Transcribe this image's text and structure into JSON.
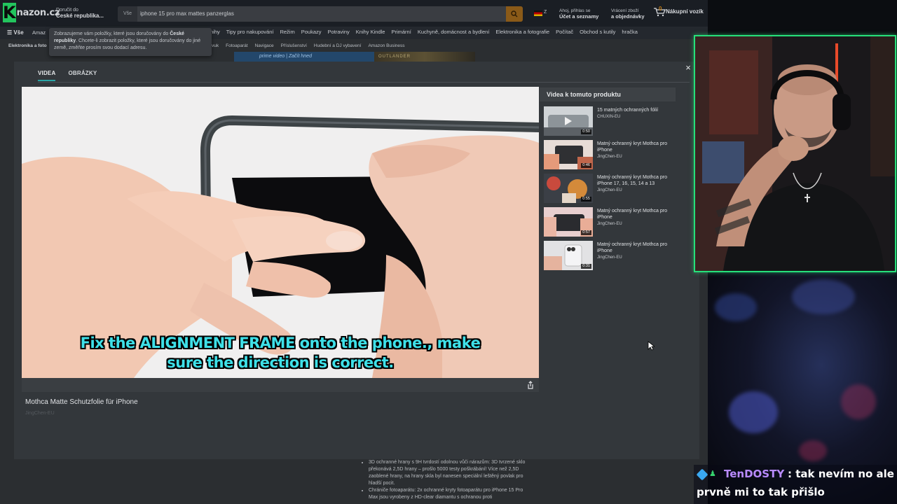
{
  "amazon": {
    "logo_text": "nazon.cz",
    "logo_letter": "K",
    "deliver_label": "Doručit do",
    "deliver_location": "České republika...",
    "search_category": "Vše",
    "search_query": "iphone 15 pro max mattes panzerglas",
    "lang": "Z",
    "account_line1": "Ahoj, přihlas se",
    "account_line2": "Účet a seznamy",
    "orders_line1": "Vrácení zboží",
    "orders_line2": "a objednávky",
    "cart_count": "0",
    "cart_label": "Nákupní vozík",
    "nav_all": "Vše",
    "nav_first": "Amaz",
    "nav_items": [
      "nihy",
      "Tipy pro nakupování",
      "Režim",
      "Poukazy",
      "Potraviny",
      "Knihy Kindle",
      "Primární",
      "Kuchyně, domácnost a bydlení",
      "Elektronika a fotografie",
      "Počítač",
      "Obchod s kutily",
      "hračka"
    ],
    "sub_first": "Elektronika a foto",
    "sub_items": [
      "vuk",
      "Fotoaparát",
      "Navigace",
      "Příslušenství",
      "Hudební a DJ vybavení",
      "Amazon Business"
    ],
    "tooltip_text_1": "Zobrazujeme vám položky, které jsou doručovány do",
    "tooltip_bold_1": "České republiky",
    "tooltip_text_2": ". Chcete-li zobrazit položky, které jsou doručovány do jiné země, změňte prosím svou dodací adresu.",
    "banner_text": "prime video | Začít hned",
    "banner2_text": "OUTLANDER"
  },
  "modal": {
    "tabs": [
      {
        "label": "VIDEA",
        "active": true
      },
      {
        "label": "OBRÁZKY",
        "active": false
      }
    ],
    "subtitle_line1": "Fix the ALIGNMENT FRAME onto the phone., make",
    "subtitle_line2": "sure the direction is correct.",
    "video_title": "Mothca Matte Schutzfolie für iPhone",
    "video_subtitle": "JingChen-EU",
    "related_heading": "Videa k tomuto produktu",
    "related": [
      {
        "title": "15 matných ochranných fólií",
        "channel": "CHUXIN-EU",
        "duration": "0:50"
      },
      {
        "title": "Matný ochranný kryt Mothca pro iPhone",
        "channel": "JingChen-EU",
        "duration": "0:46"
      },
      {
        "title": "Matný ochranný kryt Mothca pro iPhone 17, 16, 15, 14 a 13",
        "channel": "JingChen-EU",
        "duration": "0:55"
      },
      {
        "title": "Matný ochranný kryt Mothca pro iPhone",
        "channel": "JingChen-EU",
        "duration": "0:57"
      },
      {
        "title": "Matný ochranný kryt Mothca pro iPhone",
        "channel": "JingChen-EU",
        "duration": "0:31"
      }
    ],
    "close_symbol": "×"
  },
  "page_bottom": {
    "para1": "3D ochranné hrany s 9H tvrdostí odolnou vůči nárazům: 3D tvrzené sklo překonává 2,5D hrany – prošlo 5000 testy poškrábání! Více než 2,5D zaoblené hrany, na hrany skla byl nanesen speciální leštěný povlak pro hladší pocit.",
    "para2": "Chrániče fotoaparátu: 2x ochranné kryty fotoaparátu pro iPhone 15 Pro Max jsou vyrobeny z HD-clear diamantu s ochranou proti"
  },
  "chat": {
    "username": "TenDOSTY",
    "message_line1": ": tak nevím no ale",
    "message_line2": "prvně mi to tak přišlo",
    "username_color": "#b98bff"
  },
  "colors": {
    "accent": "#2aa5a6",
    "cam_border": "#26e07a",
    "subtitle": "#3ee0e8"
  }
}
